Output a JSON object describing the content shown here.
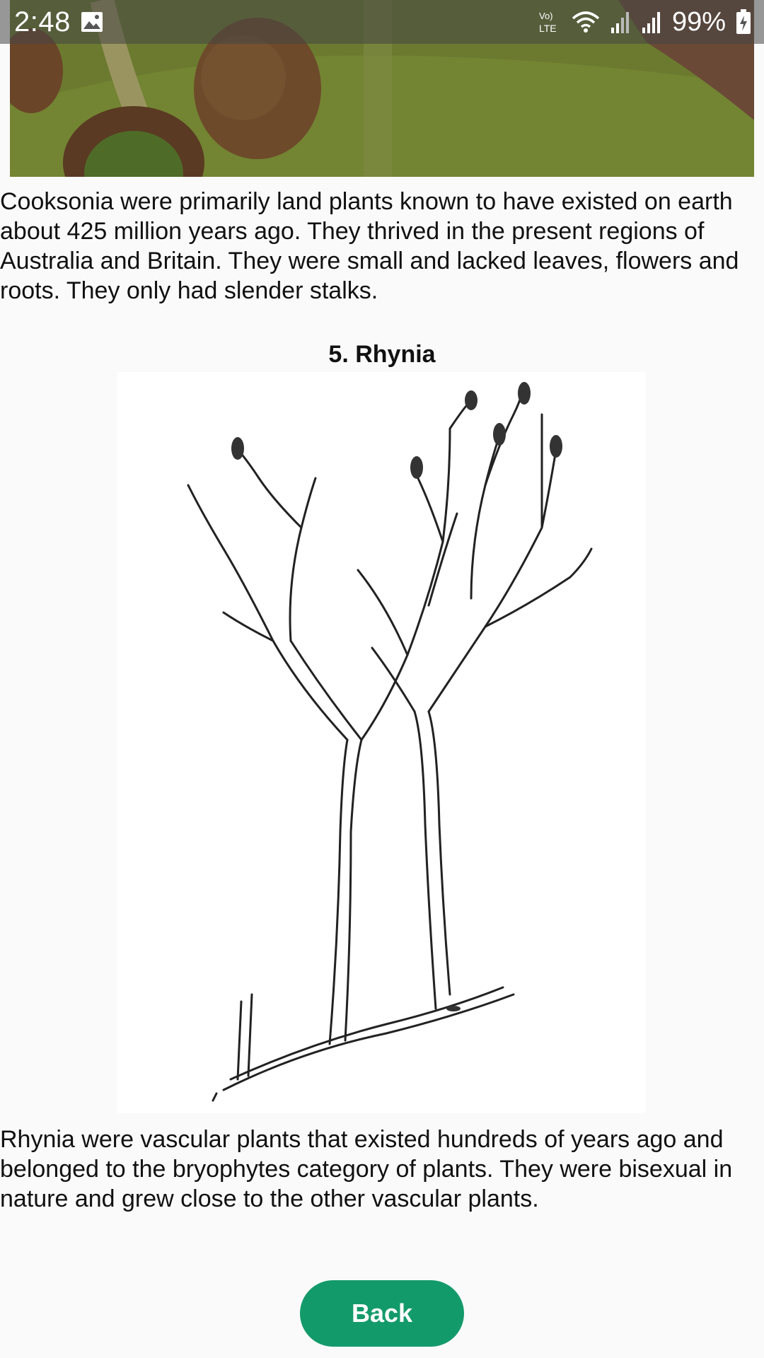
{
  "status_bar": {
    "time": "2:48",
    "battery_percent": "99%",
    "network_label": "Vo) LTE",
    "icons": [
      "gallery-icon",
      "volte-icon",
      "wifi-icon",
      "signal-icon",
      "signal-icon",
      "battery-charging-icon"
    ]
  },
  "content": {
    "cooksonia_text": "Cooksonia were primarily land plants known to have existed on earth about 425 million years ago. They thrived in the present regions of Australia and Britain. They were small and lacked leaves, flowers and roots. They only had slender stalks.",
    "rhynia_title": "5. Rhynia",
    "rhynia_text": "Rhynia were vascular plants that existed hundreds of years ago and belonged to the bryophytes category of plants. They were bisexual in nature and grew close to the other vascular plants."
  },
  "back_button": {
    "label": "Back"
  },
  "colors": {
    "accent": "#139a6b",
    "background": "#fafafa",
    "status_bar": "#464646"
  }
}
